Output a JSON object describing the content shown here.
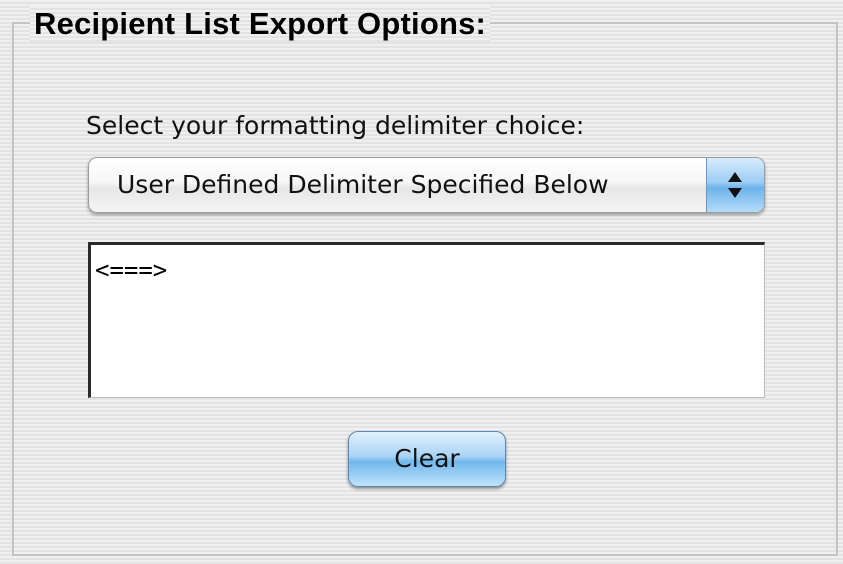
{
  "group": {
    "title": "Recipient List Export Options:"
  },
  "delimiter_prompt": "Select your formatting delimiter choice:",
  "delimiter_select": {
    "selected": "User Defined Delimiter Specified Below",
    "icon": "updown-arrows-icon"
  },
  "custom_delimiter": {
    "value": "<===>"
  },
  "actions": {
    "clear_label": "Clear"
  },
  "colors": {
    "accent_blue": "#9ccdf4",
    "panel_stripe_light": "#f0f0f0",
    "panel_stripe_dark": "#e3e3e3"
  }
}
